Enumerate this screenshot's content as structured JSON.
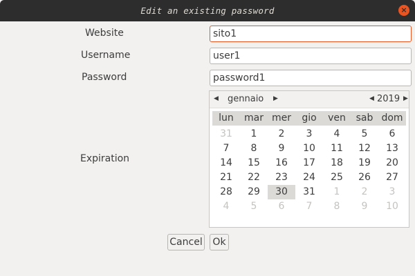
{
  "window": {
    "title": "Edit an existing password",
    "close_glyph": "×"
  },
  "form": {
    "website_label": "Website",
    "website_value": "sito1",
    "username_label": "Username",
    "username_value": "user1",
    "password_label": "Password",
    "password_value": "password1",
    "expiration_label": "Expiration"
  },
  "calendar": {
    "month": "gennaio",
    "year": "2019",
    "prev_glyph": "◀",
    "next_glyph": "▶",
    "weekdays": [
      "lun",
      "mar",
      "mer",
      "gio",
      "ven",
      "sab",
      "dom"
    ],
    "selected_day": 30,
    "days": [
      {
        "d": "31",
        "o": true
      },
      {
        "d": "1",
        "o": false
      },
      {
        "d": "2",
        "o": false
      },
      {
        "d": "3",
        "o": false
      },
      {
        "d": "4",
        "o": false
      },
      {
        "d": "5",
        "o": false
      },
      {
        "d": "6",
        "o": false
      },
      {
        "d": "7",
        "o": false
      },
      {
        "d": "8",
        "o": false
      },
      {
        "d": "9",
        "o": false
      },
      {
        "d": "10",
        "o": false
      },
      {
        "d": "11",
        "o": false
      },
      {
        "d": "12",
        "o": false
      },
      {
        "d": "13",
        "o": false
      },
      {
        "d": "14",
        "o": false
      },
      {
        "d": "15",
        "o": false
      },
      {
        "d": "16",
        "o": false
      },
      {
        "d": "17",
        "o": false
      },
      {
        "d": "18",
        "o": false
      },
      {
        "d": "19",
        "o": false
      },
      {
        "d": "20",
        "o": false
      },
      {
        "d": "21",
        "o": false
      },
      {
        "d": "22",
        "o": false
      },
      {
        "d": "23",
        "o": false
      },
      {
        "d": "24",
        "o": false
      },
      {
        "d": "25",
        "o": false
      },
      {
        "d": "26",
        "o": false
      },
      {
        "d": "27",
        "o": false
      },
      {
        "d": "28",
        "o": false
      },
      {
        "d": "29",
        "o": false
      },
      {
        "d": "30",
        "o": false
      },
      {
        "d": "31",
        "o": false
      },
      {
        "d": "1",
        "o": true
      },
      {
        "d": "2",
        "o": true
      },
      {
        "d": "3",
        "o": true
      },
      {
        "d": "4",
        "o": true
      },
      {
        "d": "5",
        "o": true
      },
      {
        "d": "6",
        "o": true
      },
      {
        "d": "7",
        "o": true
      },
      {
        "d": "8",
        "o": true
      },
      {
        "d": "9",
        "o": true
      },
      {
        "d": "10",
        "o": true
      }
    ]
  },
  "buttons": {
    "cancel_label": "Cancel",
    "ok_label": "Ok"
  },
  "colors": {
    "accent": "#e95420",
    "titlebar": "#2d2d2d",
    "background": "#f2f1f0"
  },
  "icons": {
    "close": "close-icon",
    "prev": "triangle-left-icon",
    "next": "triangle-right-icon"
  }
}
